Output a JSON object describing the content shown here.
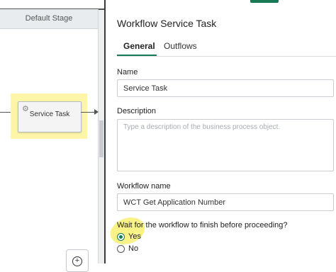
{
  "canvas": {
    "stage_title": "Default Stage",
    "task_label": "Service Task",
    "zoom_in_symbol": "+"
  },
  "panel": {
    "title": "Workflow Service Task",
    "tabs": [
      {
        "label": "General",
        "active": true
      },
      {
        "label": "Outflows",
        "active": false
      }
    ],
    "name_label": "Name",
    "name_value": "Service Task",
    "description_label": "Description",
    "description_placeholder": "Type a description of the business process object.",
    "workflow_name_label": "Workflow name",
    "workflow_name_value": "WCT Get Application Number",
    "wait_question": "Wait for the workflow to finish before proceeding?",
    "options": [
      {
        "label": "Yes",
        "selected": true
      },
      {
        "label": "No",
        "selected": false
      }
    ]
  },
  "colors": {
    "accent": "#177a55",
    "highlight": "#fdf6a8"
  },
  "icons": {
    "task_settings": "gear-icon",
    "zoom": "zoom-in-icon",
    "collapse": "caret-right-icon"
  }
}
